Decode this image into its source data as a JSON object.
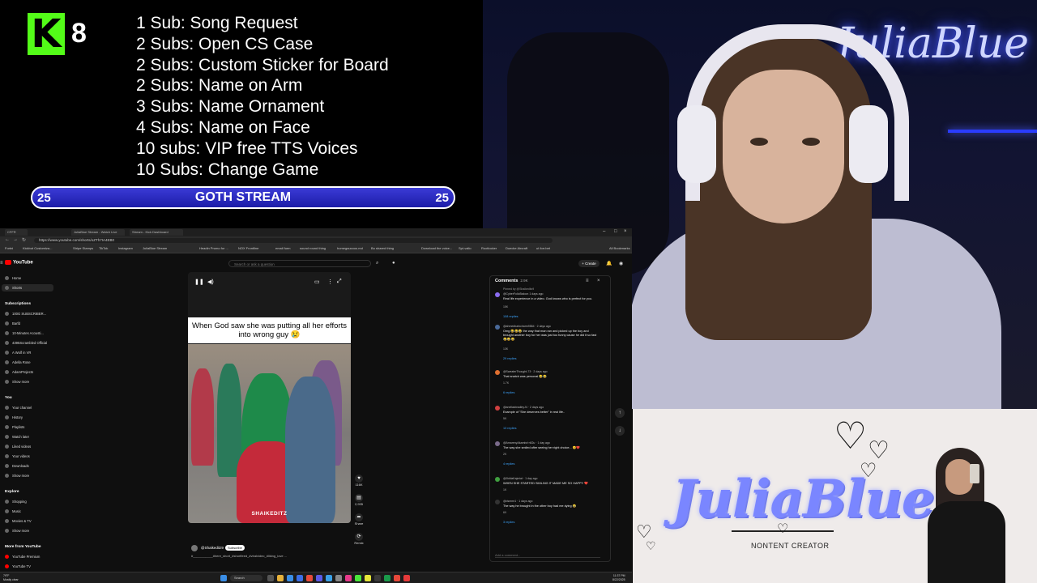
{
  "overlay": {
    "kick_logo_letter": "K",
    "viewer_count": "8",
    "sub_rewards": [
      "1 Sub: Song Request",
      "2 Subs: Open CS Case",
      "2 Subs: Custom Sticker for Board",
      "2 Subs: Name on Arm",
      "3 Subs: Name Ornament",
      "4 Subs: Name on Face",
      "10 subs: VIP free TTS Voices",
      "10 Subs: Change Game"
    ],
    "goal": {
      "left": "25",
      "title": "GOTH STREAM",
      "right": "25",
      "color": "#2a2ac4"
    }
  },
  "webcam": {
    "neon_sign": "JuliaBlue",
    "accent": "#4a5cff"
  },
  "browser": {
    "tabs": [
      "CFFR",
      "JuliaBlue Stream - Watch Live",
      "Stream - Kick Dashboard"
    ],
    "url": "https://www.youtube.com/shorts/oZTh7IA4EB0",
    "bookmarks": [
      "Fortni",
      "Kickbot Customiza...",
      "Stripe Stamps",
      "TikTok",
      "Instagram",
      "JuliaBlue Stream",
      "Headin Promo for ...",
      "NOX Frontline",
      "email fuen",
      "sound round thing",
      "homegaucous.md",
      "Bo shared thing",
      "Download the voice...",
      "Spt-vallo",
      "Rootlocker",
      "Duecke Aircraft",
      "ut forr.bet",
      "All Bookmarks"
    ],
    "youtube": {
      "logo_text": "YouTube",
      "search_placeholder": "Search or ask a question",
      "create_label": "+ Create",
      "sidebar": {
        "main": [
          "Home",
          "Shorts"
        ],
        "subscriptions_heading": "Subscriptions",
        "subscriptions": [
          "100G SUBSCRIBER...",
          "Barfd",
          "10-Minutes Acousti...",
          "4395Scrambled Official",
          "A Wolf in VR",
          "Adella Rose",
          "AdamProjects"
        ],
        "show_more": "Show more",
        "you_heading": "You",
        "you": [
          "Your channel",
          "History",
          "Playlists",
          "Watch later",
          "Liked videos",
          "Your videos",
          "Downloads"
        ],
        "show_more_2": "Show more",
        "explore_heading": "Explore",
        "explore": [
          "Shopping",
          "Music",
          "Movies & TV"
        ],
        "show_more_3": "Show more",
        "more_heading": "More from YouTube",
        "more": [
          "YouTube Premium",
          "YouTube TV"
        ]
      },
      "short": {
        "caption": "When God saw she was putting all her efforts into wrong guy 😢",
        "watermark": "SHAIKEDITZ",
        "channel": "@Shaikeditz9",
        "subscribe": "Subscribe",
        "description": "#___________#here_short_#shortfeed_#viralvideo_#liking_love ...",
        "actions": [
          {
            "icon": "like-icon",
            "label": "116K"
          },
          {
            "icon": "comment-icon",
            "label": "2,935"
          },
          {
            "icon": "share-icon",
            "label": "Share"
          },
          {
            "icon": "remix-icon",
            "label": "Remix"
          }
        ]
      },
      "comments": {
        "title": "Comments",
        "count": "2.9K",
        "items": [
          {
            "pinned": "Pinned by @Shaikeditz9",
            "user": "@CyberFolioBaloon 1 days ago",
            "text": "Real life experience in a video. God knows who is perfect for you.",
            "likes": "15K",
            "replies": "108 replies",
            "color": "#8a6cf0"
          },
          {
            "user": "@ahmedbarkcharm9584 · 2 days ago",
            "text": "Omg 😂😂😂 the way that man ran and picked up the boy and brought another boy for her was just too funny cause he did it so fast 😂😂😂",
            "likes": "13K",
            "replies": "29 replies",
            "color": "#4a6a9a"
          },
          {
            "user": "@SweaterThought-73 · 2 days ago",
            "text": "That snatch was personal 😂😂",
            "likes": "1.7K",
            "replies": "6 replies",
            "color": "#e07030"
          },
          {
            "user": "@anellasbradleyJ4 · 2 days ago",
            "text": "Example of \"She deserves better\" in real life..",
            "likes": "5K",
            "replies": "13 replies",
            "color": "#d04040"
          },
          {
            "user": "@AmarenyAkambd·n52u · 1 day ago",
            "text": "The way she smiled after seeing her right choice... 😊❤️",
            "likes": "2K",
            "replies": "4 replies",
            "color": "#7a6a8a"
          },
          {
            "user": "@JkkiiaKajmiat · 1 day ago",
            "text": "WHEN SHE STARTED SMILING IT MADE ME SO HAPPY ❤️",
            "likes": "1K",
            "replies": "",
            "color": "#40a040"
          },
          {
            "user": "@dsmmr1 · 1 days ago",
            "text": "The way he brought in the other boy had me dying 😂",
            "likes": "69",
            "replies": "3 replies",
            "color": "#333333"
          }
        ],
        "add_placeholder": "Add a comment..."
      }
    },
    "taskbar": {
      "weather": "79°F\nMostly clear",
      "search": "Search",
      "time": "11:37 PM",
      "date": "8/22/2025"
    }
  },
  "brand": {
    "logo": "JuliaBlue",
    "tagline": "NONTENT CREATOR",
    "logo_color": "#7a86ff"
  }
}
